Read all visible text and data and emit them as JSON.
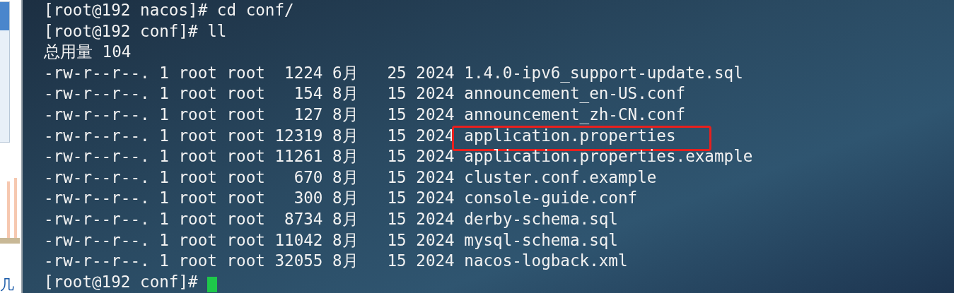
{
  "side_window": {
    "glyph": "几"
  },
  "terminal": {
    "lines": [
      {
        "text": "[root@192 nacos]# cd conf/",
        "highlighted": false,
        "cursor": false
      },
      {
        "text": "[root@192 conf]# ll",
        "highlighted": false,
        "cursor": false
      },
      {
        "text": "总用量 104",
        "highlighted": false,
        "cursor": false
      },
      {
        "text": "-rw-r--r--. 1 root root  1224 6月   25 2024 1.4.0-ipv6_support-update.sql",
        "highlighted": false,
        "cursor": false
      },
      {
        "text": "-rw-r--r--. 1 root root   154 8月   15 2024 announcement_en-US.conf",
        "highlighted": false,
        "cursor": false
      },
      {
        "text": "-rw-r--r--. 1 root root   127 8月   15 2024 announcement_zh-CN.conf",
        "highlighted": false,
        "cursor": false
      },
      {
        "text": "-rw-r--r--. 1 root root 12319 8月   15 2024 application.properties",
        "highlighted": true,
        "cursor": false
      },
      {
        "text": "-rw-r--r--. 1 root root 11261 8月   15 2024 application.properties.example",
        "highlighted": false,
        "cursor": false
      },
      {
        "text": "-rw-r--r--. 1 root root   670 8月   15 2024 cluster.conf.example",
        "highlighted": false,
        "cursor": false
      },
      {
        "text": "-rw-r--r--. 1 root root   300 8月   15 2024 console-guide.conf",
        "highlighted": false,
        "cursor": false
      },
      {
        "text": "-rw-r--r--. 1 root root  8734 8月   15 2024 derby-schema.sql",
        "highlighted": false,
        "cursor": false
      },
      {
        "text": "-rw-r--r--. 1 root root 11042 8月   15 2024 mysql-schema.sql",
        "highlighted": false,
        "cursor": false
      },
      {
        "text": "-rw-r--r--. 1 root root 32055 8月   15 2024 nacos-logback.xml",
        "highlighted": false,
        "cursor": false
      },
      {
        "text": "[root@192 conf]# ",
        "highlighted": false,
        "cursor": true
      }
    ]
  }
}
